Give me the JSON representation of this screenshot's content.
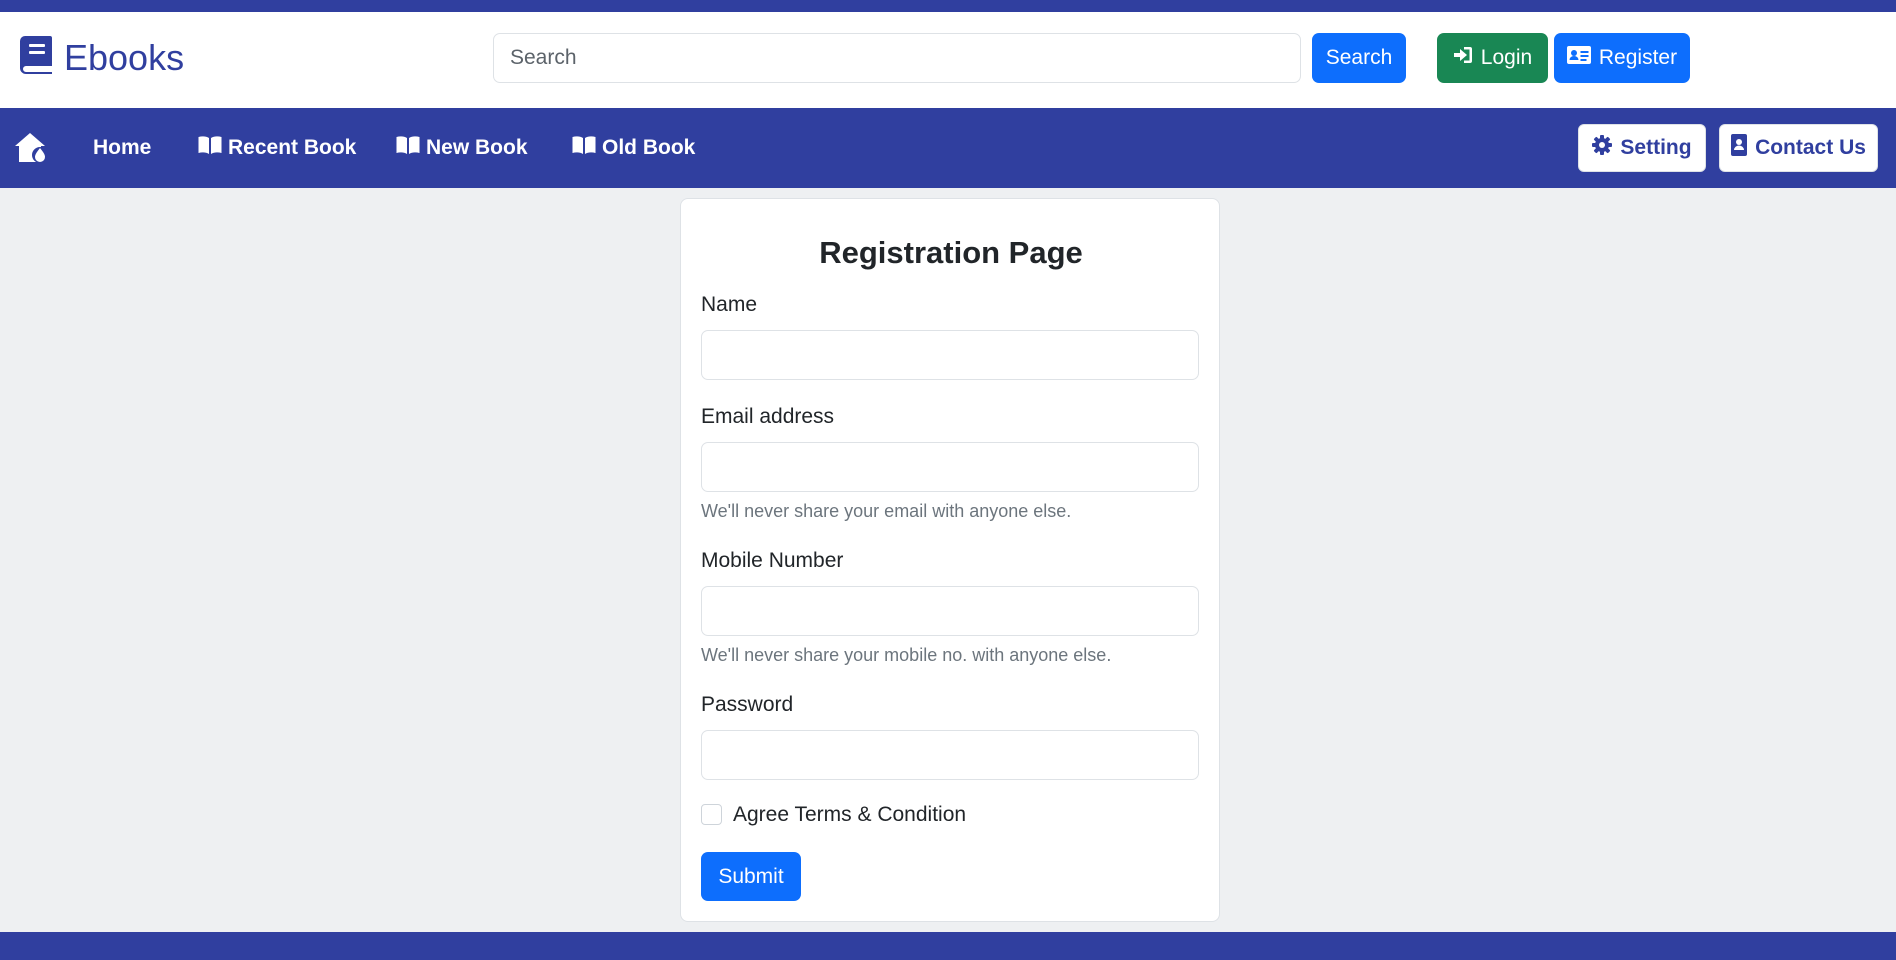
{
  "brand": {
    "name": "Ebooks",
    "icon": "book-icon"
  },
  "header": {
    "search_placeholder": "Search",
    "search_button": "Search",
    "login_button": "Login",
    "register_button": "Register"
  },
  "nav": {
    "home_icon": "home-icon",
    "links": [
      "Home",
      "Recent Book",
      "New Book",
      "Old Book"
    ],
    "setting_button": "Setting",
    "contact_button": "Contact Us"
  },
  "form": {
    "title": "Registration Page",
    "name_label": "Name",
    "email_label": "Email address",
    "email_help": "We'll never share your email with anyone else.",
    "mobile_label": "Mobile Number",
    "mobile_help": "We'll never share your mobile no. with anyone else.",
    "password_label": "Password",
    "terms_label": "Agree Terms & Condition",
    "submit_button": "Submit"
  },
  "colors": {
    "brand": "#303f9f",
    "primary": "#0d6efd",
    "success": "#198754",
    "page_bg": "#eef0f2"
  }
}
